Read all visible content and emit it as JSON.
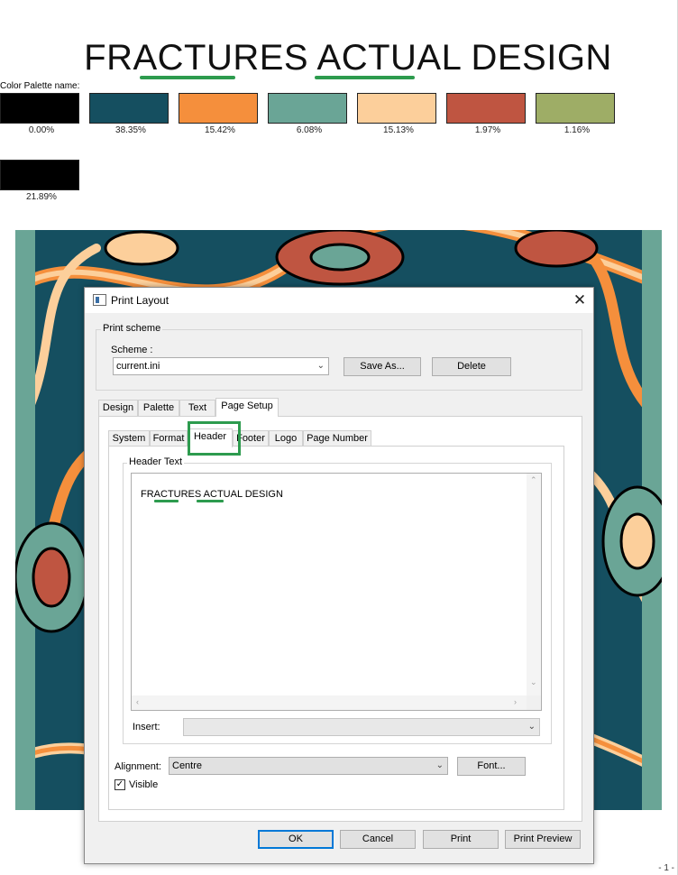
{
  "document": {
    "title": "FRACTURES ACTUAL DESIGN",
    "palette_label": "Color Palette name:",
    "page_number": "- 1 -"
  },
  "palette": [
    {
      "color": "#000000",
      "percent": "0.00%"
    },
    {
      "color": "#154f60",
      "percent": "38.35%"
    },
    {
      "color": "#f58f3c",
      "percent": "15.42%"
    },
    {
      "color": "#6aa596",
      "percent": "6.08%"
    },
    {
      "color": "#fccf9b",
      "percent": "15.13%"
    },
    {
      "color": "#bf5541",
      "percent": "1.97%"
    },
    {
      "color": "#9ead66",
      "percent": "1.16%"
    },
    {
      "color": "#000000",
      "percent": "21.89%"
    }
  ],
  "dialog": {
    "title": "Print Layout",
    "close_glyph": "✕",
    "print_scheme": {
      "group_label": "Print scheme",
      "scheme_label": "Scheme :",
      "scheme_value": "current.ini",
      "save_as_label": "Save As...",
      "delete_label": "Delete"
    },
    "main_tabs": [
      {
        "label": "Design"
      },
      {
        "label": "Palette"
      },
      {
        "label": "Text"
      },
      {
        "label": "Page Setup"
      }
    ],
    "sub_tabs": [
      {
        "label": "System"
      },
      {
        "label": "Format"
      },
      {
        "label": "Header"
      },
      {
        "label": "Footer"
      },
      {
        "label": "Logo"
      },
      {
        "label": "Page Number"
      }
    ],
    "header_text": {
      "group_label": "Header Text",
      "content": "FRACTURES ACTUAL DESIGN"
    },
    "insert_label": "Insert:",
    "insert_value": "",
    "alignment_label": "Alignment:",
    "alignment_value": "Centre",
    "font_button_label": "Font...",
    "visible_label": "Visible",
    "visible_checked": true,
    "check_glyph": "✓",
    "buttons": {
      "ok": "OK",
      "cancel": "Cancel",
      "print": "Print",
      "print_preview": "Print Preview"
    }
  },
  "accent_color": "#2d9b4e"
}
